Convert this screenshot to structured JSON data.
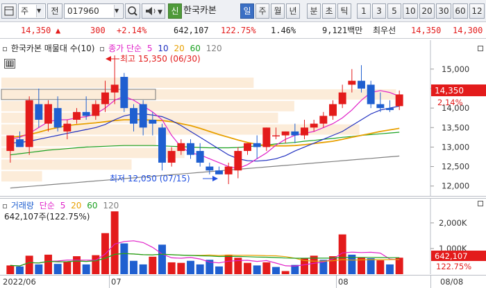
{
  "toolbar": {
    "market_label": "주",
    "prev_label": "전",
    "code_value": "017960",
    "corner_label": "신",
    "stock_name": "한국카본",
    "periods": [
      "일",
      "주",
      "월",
      "년",
      "분",
      "초",
      "틱"
    ],
    "selected_period": "일",
    "intervals": [
      "1",
      "3",
      "5",
      "10",
      "20",
      "30",
      "60",
      "12"
    ]
  },
  "quote": {
    "price": "14,350",
    "change_arrow": "▲",
    "change": "300",
    "change_pct": "+2.14%",
    "volume": "642,107",
    "volume_ratio": "122.75%",
    "turnover_ratio": "1.46%",
    "amount": "9,121백만",
    "best_bid_label": "최우선",
    "best_bid": "14,350",
    "best_ask": "14,300"
  },
  "price_chart": {
    "legend_title": "한국카본 매물대 수(10)",
    "legend_ma_label": "종가 단순",
    "legend_ma": [
      "5",
      "10",
      "20",
      "60",
      "120"
    ],
    "annotation_high": "최고 15,350 (06/30)",
    "annotation_low": "최저 12,050 (07/15)",
    "current_price_tag": "14,350",
    "current_pct_tag": "2.14%",
    "y_ticks": [
      "15,000",
      "14,500",
      "14,000",
      "13,500",
      "13,000",
      "12,500",
      "12,000"
    ]
  },
  "volume_chart": {
    "legend_title": "거래량",
    "legend_ma_label": "단순",
    "legend_ma": [
      "5",
      "20",
      "60",
      "120"
    ],
    "value_line": "642,107주(122.75%)",
    "y_ticks": [
      "2,000K",
      "1,000K"
    ],
    "current_volume_tag": "642,107",
    "current_pct_tag": "122.75%"
  },
  "x_axis": {
    "labels": [
      "2022/06",
      "07",
      "08",
      "08/08"
    ]
  },
  "colors": {
    "up": "#e31b1b",
    "down": "#1f5fd0",
    "ma5": "#e020c8",
    "ma10": "#2030c0",
    "ma20": "#e8a000",
    "ma60": "#1aa020",
    "ma120": "#808080"
  },
  "chart_data": {
    "type": "candlestick",
    "candles": [
      {
        "o": 12900,
        "h": 13300,
        "l": 12600,
        "c": 13300
      },
      {
        "o": 13200,
        "h": 13400,
        "l": 13000,
        "c": 13000
      },
      {
        "o": 13000,
        "h": 14300,
        "l": 12800,
        "c": 14200
      },
      {
        "o": 14100,
        "h": 14500,
        "l": 13500,
        "c": 13700
      },
      {
        "o": 13600,
        "h": 14200,
        "l": 13400,
        "c": 14100
      },
      {
        "o": 14000,
        "h": 14300,
        "l": 13400,
        "c": 13500
      },
      {
        "o": 13400,
        "h": 13700,
        "l": 13200,
        "c": 13600
      },
      {
        "o": 13700,
        "h": 14000,
        "l": 13600,
        "c": 13900
      },
      {
        "o": 13900,
        "h": 14300,
        "l": 13700,
        "c": 13800
      },
      {
        "o": 13800,
        "h": 14200,
        "l": 13700,
        "c": 14100
      },
      {
        "o": 14100,
        "h": 14700,
        "l": 13900,
        "c": 14400
      },
      {
        "o": 14400,
        "h": 15350,
        "l": 14100,
        "c": 14600
      },
      {
        "o": 14800,
        "h": 14900,
        "l": 13900,
        "c": 14000
      },
      {
        "o": 14000,
        "h": 14100,
        "l": 13400,
        "c": 13600
      },
      {
        "o": 14100,
        "h": 14200,
        "l": 13300,
        "c": 13500
      },
      {
        "o": 13700,
        "h": 13900,
        "l": 13300,
        "c": 13600
      },
      {
        "o": 13500,
        "h": 13600,
        "l": 12400,
        "c": 12600
      },
      {
        "o": 12600,
        "h": 13000,
        "l": 12500,
        "c": 12900
      },
      {
        "o": 12900,
        "h": 13200,
        "l": 12800,
        "c": 13100
      },
      {
        "o": 13100,
        "h": 13200,
        "l": 12700,
        "c": 12800
      },
      {
        "o": 12900,
        "h": 13100,
        "l": 12500,
        "c": 12600
      },
      {
        "o": 12500,
        "h": 12600,
        "l": 12300,
        "c": 12400
      },
      {
        "o": 12400,
        "h": 12500,
        "l": 12300,
        "c": 12300
      },
      {
        "o": 12300,
        "h": 12600,
        "l": 12050,
        "c": 12500
      },
      {
        "o": 12400,
        "h": 13000,
        "l": 12200,
        "c": 12900
      },
      {
        "o": 12900,
        "h": 13100,
        "l": 12800,
        "c": 13100
      },
      {
        "o": 13100,
        "h": 13300,
        "l": 12700,
        "c": 13000
      },
      {
        "o": 13000,
        "h": 13500,
        "l": 12900,
        "c": 13500
      },
      {
        "o": 13300,
        "h": 13500,
        "l": 13200,
        "c": 13300
      },
      {
        "o": 13300,
        "h": 13400,
        "l": 13100,
        "c": 13400
      },
      {
        "o": 13400,
        "h": 13600,
        "l": 13100,
        "c": 13300
      },
      {
        "o": 13300,
        "h": 13700,
        "l": 13200,
        "c": 13500
      },
      {
        "o": 13500,
        "h": 13700,
        "l": 13400,
        "c": 13600
      },
      {
        "o": 13600,
        "h": 13900,
        "l": 13500,
        "c": 13800
      },
      {
        "o": 13800,
        "h": 14200,
        "l": 13700,
        "c": 14100
      },
      {
        "o": 14100,
        "h": 14600,
        "l": 14000,
        "c": 14400
      },
      {
        "o": 14600,
        "h": 15000,
        "l": 14400,
        "c": 14700
      },
      {
        "o": 14700,
        "h": 15100,
        "l": 14400,
        "c": 14500
      },
      {
        "o": 14600,
        "h": 14700,
        "l": 14000,
        "c": 14100
      },
      {
        "o": 14100,
        "h": 14400,
        "l": 13900,
        "c": 14000
      },
      {
        "o": 14000,
        "h": 14200,
        "l": 13900,
        "c": 13950
      },
      {
        "o": 14050,
        "h": 14450,
        "l": 13950,
        "c": 14350
      }
    ],
    "volume": [
      {
        "v": 340,
        "up": true
      },
      {
        "v": 300,
        "up": false
      },
      {
        "v": 720,
        "up": true
      },
      {
        "v": 380,
        "up": false
      },
      {
        "v": 760,
        "up": true
      },
      {
        "v": 400,
        "up": false
      },
      {
        "v": 500,
        "up": true
      },
      {
        "v": 700,
        "up": true
      },
      {
        "v": 380,
        "up": false
      },
      {
        "v": 740,
        "up": true
      },
      {
        "v": 1600,
        "up": true
      },
      {
        "v": 2450,
        "up": true
      },
      {
        "v": 1200,
        "up": false
      },
      {
        "v": 520,
        "up": false
      },
      {
        "v": 380,
        "up": false
      },
      {
        "v": 680,
        "up": true
      },
      {
        "v": 1150,
        "up": false
      },
      {
        "v": 460,
        "up": true
      },
      {
        "v": 440,
        "up": true
      },
      {
        "v": 520,
        "up": false
      },
      {
        "v": 380,
        "up": false
      },
      {
        "v": 560,
        "up": false
      },
      {
        "v": 300,
        "up": false
      },
      {
        "v": 760,
        "up": true
      },
      {
        "v": 640,
        "up": true
      },
      {
        "v": 440,
        "up": true
      },
      {
        "v": 340,
        "up": false
      },
      {
        "v": 460,
        "up": true
      },
      {
        "v": 280,
        "up": false
      },
      {
        "v": 120,
        "up": true
      },
      {
        "v": 360,
        "up": false
      },
      {
        "v": 620,
        "up": true
      },
      {
        "v": 720,
        "up": true
      },
      {
        "v": 560,
        "up": false
      },
      {
        "v": 700,
        "up": true
      },
      {
        "v": 1550,
        "up": true
      },
      {
        "v": 760,
        "up": false
      },
      {
        "v": 640,
        "up": true
      },
      {
        "v": 620,
        "up": false
      },
      {
        "v": 540,
        "up": true
      },
      {
        "v": 380,
        "up": false
      },
      {
        "v": 642,
        "up": true
      }
    ],
    "ma": {
      "ma5": [
        13200,
        13250,
        13350,
        13500,
        13650,
        13700,
        13700,
        13750,
        13780,
        13850,
        14000,
        14200,
        14300,
        14200,
        14050,
        13900,
        13700,
        13300,
        13000,
        12850,
        12800,
        12700,
        12600,
        12500,
        12450,
        12550,
        12700,
        12850,
        13050,
        13200,
        13300,
        13350,
        13400,
        13500,
        13600,
        13750,
        13950,
        14200,
        14400,
        14450,
        14400,
        14300
      ],
      "ma10": [
        13100,
        13120,
        13150,
        13200,
        13250,
        13300,
        13350,
        13400,
        13450,
        13500,
        13580,
        13700,
        13800,
        13850,
        13850,
        13820,
        13780,
        13680,
        13550,
        13400,
        13250,
        13100,
        12950,
        12800,
        12700,
        12650,
        12640,
        12660,
        12700,
        12780,
        12900,
        13000,
        13100,
        13200,
        13300,
        13400,
        13550,
        13700,
        13850,
        13950,
        14000,
        14050
      ],
      "ma20": [
        13250,
        13280,
        13320,
        13380,
        13450,
        13500,
        13550,
        13580,
        13600,
        13620,
        13650,
        13680,
        13700,
        13700,
        13700,
        13690,
        13680,
        13650,
        13600,
        13550,
        13480,
        13400,
        13320,
        13250,
        13180,
        13120,
        13070,
        13040,
        13030,
        13030,
        13040,
        13060,
        13090,
        13120,
        13150,
        13200,
        13250,
        13300,
        13350,
        13400,
        13440,
        13480
      ],
      "ma60": [
        12800,
        12830,
        12860,
        12890,
        12920,
        12940,
        12960,
        12980,
        13000,
        13010,
        13020,
        13030,
        13040,
        13040,
        13040,
        13040,
        13030,
        13020,
        13010,
        13000,
        12990,
        12980,
        12980,
        12980,
        12990,
        13010,
        13030,
        13050,
        13080,
        13100,
        13120,
        13150,
        13170,
        13200,
        13220,
        13250,
        13270,
        13300,
        13320,
        13340,
        13360,
        13380
      ],
      "ma120": [
        11950,
        11970,
        11990,
        12010,
        12030,
        12050,
        12070,
        12090,
        12110,
        12130,
        12150,
        12170,
        12190,
        12210,
        12230,
        12250,
        12270,
        12290,
        12310,
        12330,
        12350,
        12370,
        12390,
        12410,
        12430,
        12450,
        12470,
        12490,
        12510,
        12530,
        12550,
        12570,
        12590,
        12610,
        12630,
        12650,
        12670,
        12690,
        12710,
        12730,
        12750,
        12770
      ]
    },
    "volume_profile": [
      {
        "price": 14650,
        "len": 0.62
      },
      {
        "price": 14350,
        "len": 0.97
      },
      {
        "price": 14050,
        "len": 0.72
      },
      {
        "price": 13750,
        "len": 0.68
      },
      {
        "price": 13450,
        "len": 0.88
      },
      {
        "price": 13150,
        "len": 0.38
      },
      {
        "price": 12850,
        "len": 0.45
      },
      {
        "price": 12550,
        "len": 0.32
      },
      {
        "price": 12250,
        "len": 0.1
      }
    ],
    "ylim": [
      11800,
      15600
    ],
    "volume_ylim": [
      0,
      2700
    ]
  }
}
